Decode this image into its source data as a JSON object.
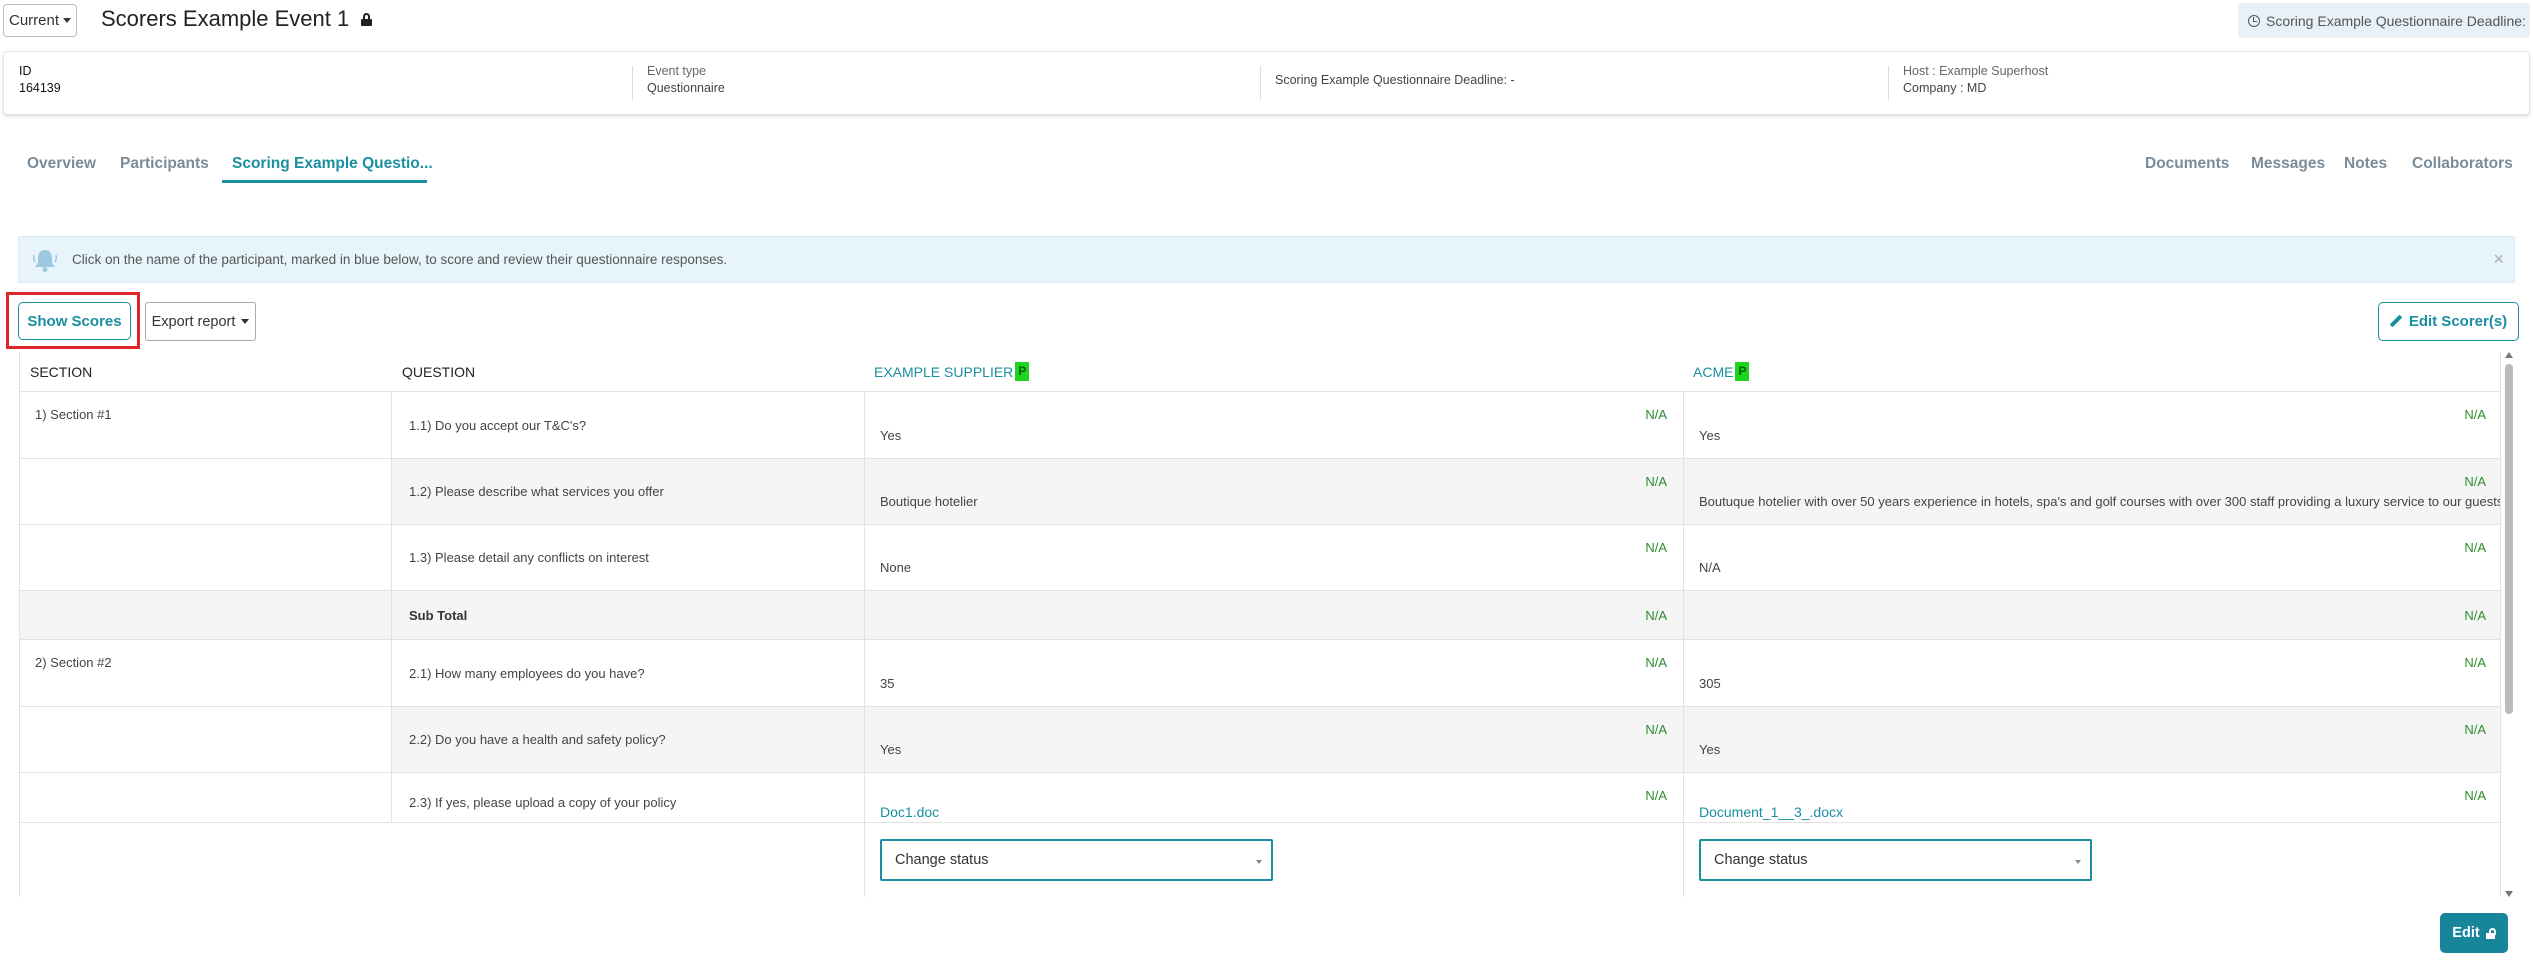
{
  "header": {
    "current_label": "Current",
    "event_title": "Scorers Example Event 1",
    "deadline_pill": "Scoring Example Questionnaire Deadline: -"
  },
  "info": {
    "id_label": "ID",
    "id_value": "164139",
    "event_type_label": "Event type",
    "event_type_value": "Questionnaire",
    "deadline_text": "Scoring Example Questionnaire Deadline: -",
    "host_text": "Host : Example Superhost",
    "company_text": "Company : MD"
  },
  "tabs": {
    "overview": "Overview",
    "participants": "Participants",
    "scoring": "Scoring Example Questio...",
    "documents": "Documents",
    "messages": "Messages",
    "notes": "Notes",
    "collaborators": "Collaborators"
  },
  "alert": {
    "text": "Click on the name of the participant, marked in blue below, to score and review their questionnaire responses.",
    "close": "×"
  },
  "toolbar": {
    "show_scores": "Show Scores",
    "export_report": "Export report",
    "edit_scorers": "Edit Scorer(s)"
  },
  "table": {
    "headers": {
      "section": "SECTION",
      "question": "QUESTION",
      "supplier1": "EXAMPLE SUPPLIER",
      "supplier2": "ACME",
      "badge": "P"
    },
    "sections": {
      "s1": "1) Section #1",
      "s2": "2) Section #2"
    },
    "rows": [
      {
        "q": "1.1) Do you accept our T&C's?",
        "a1": "Yes",
        "a2": "Yes",
        "score1": "N/A",
        "score2": "N/A"
      },
      {
        "q": "1.2) Please describe what services you offer",
        "a1": "Boutique hotelier",
        "a2": "Boutuque hotelier with over 50 years experience in hotels, spa's and golf courses with over 300 staff providing a luxury service to our guests",
        "score1": "N/A",
        "score2": "N/A"
      },
      {
        "q": "1.3) Please detail any conflicts on interest",
        "a1": "None",
        "a2": "N/A",
        "score1": "N/A",
        "score2": "N/A"
      },
      {
        "q": "2.1) How many employees do you have?",
        "a1": "35",
        "a2": "305",
        "score1": "N/A",
        "score2": "N/A"
      },
      {
        "q": "2.2) Do you have a health and safety policy?",
        "a1": "Yes",
        "a2": "Yes",
        "score1": "N/A",
        "score2": "N/A"
      },
      {
        "q": "2.3) If yes, please upload a copy of your policy",
        "a1": "Doc1.doc",
        "a2": "Document_1__3_.docx",
        "score1": "N/A",
        "score2": "N/A"
      }
    ],
    "subtotal": {
      "label": "Sub Total",
      "score1": "N/A",
      "score2": "N/A"
    },
    "change_status": "Change status"
  },
  "footer": {
    "edit": "Edit"
  },
  "colors": {
    "accent": "#1a8fa0",
    "score_green": "#2e8b2e",
    "badge_green": "#1fd41f",
    "highlight_red": "#e0262b"
  }
}
